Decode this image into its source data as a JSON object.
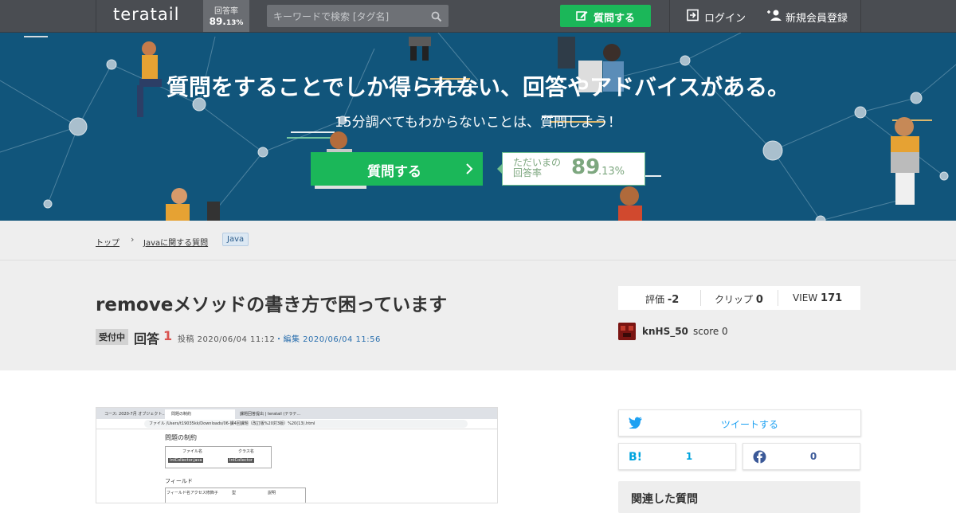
{
  "header": {
    "logo": "teratail",
    "answer_rate_label": "回答率",
    "answer_rate_int": "89.",
    "answer_rate_dec": "13%",
    "search_placeholder": "キーワードで検索 [タグ名]",
    "ask_label": "質問する",
    "login_label": "ログイン",
    "signup_label": "新規会員登録"
  },
  "hero": {
    "headline": "質問をすることでしか得られない、回答やアドバイスがある。",
    "subline": "15分調べてもわからないことは、質問しよう！",
    "cta_label": "質問する",
    "rate_label": "ただいまの回答率",
    "rate_int": "89",
    "rate_dec": ".13%"
  },
  "breadcrumb": {
    "items": [
      "トップ",
      "Javaに関する質問"
    ],
    "separator": "›",
    "tag": "Java"
  },
  "question": {
    "title": "removeメソッドの書き方で困っています",
    "status_badge": "受付中",
    "answers_label": "回答",
    "answers_count": "1",
    "posted": "投稿 2020/06/04 11:12",
    "edited": "・編集 2020/06/04 11:56",
    "stats": {
      "rating_label": "評価",
      "rating_value": "-2",
      "clip_label": "クリップ",
      "clip_value": "0",
      "view_label": "VIEW",
      "view_value": "171"
    },
    "author": {
      "name": "knHS_50",
      "score": "score 0"
    }
  },
  "screenshot": {
    "tabs": [
      "コース: 2020-7月 オブジェクト…",
      "問題の制約",
      "課題回答提出 | teratail (テラテ…"
    ],
    "url": "ファイル  /Users/t19035kk/Downloads/06-課4回課題（改訂版%20対3版）%20(13).html",
    "heading": "問題の制約",
    "table1_headers": [
      "ファイル名",
      "クラス名"
    ],
    "table1_row": [
      "IntCollector.java",
      "IntCollector"
    ],
    "section2": "フィールド",
    "table2_headers": [
      "フィールド名",
      "アクセス修飾子",
      "型",
      "説明"
    ]
  },
  "share": {
    "tweet_label": "ツイートする",
    "hatena_count": "1",
    "facebook_count": "0"
  },
  "sidebar": {
    "related_title": "関連した質問"
  },
  "colors": {
    "green": "#1bb759",
    "header_bg": "#4a4d52",
    "hero_bg": "#11557b",
    "twitter": "#1da1f2",
    "hatena": "#00a4de",
    "facebook": "#3b5998",
    "answer_count": "#d9534f"
  },
  "icons": [
    "search-icon",
    "edit-icon",
    "login-icon",
    "add-user-icon",
    "chevron-right-icon",
    "twitter-icon",
    "hatena-icon",
    "facebook-icon"
  ]
}
